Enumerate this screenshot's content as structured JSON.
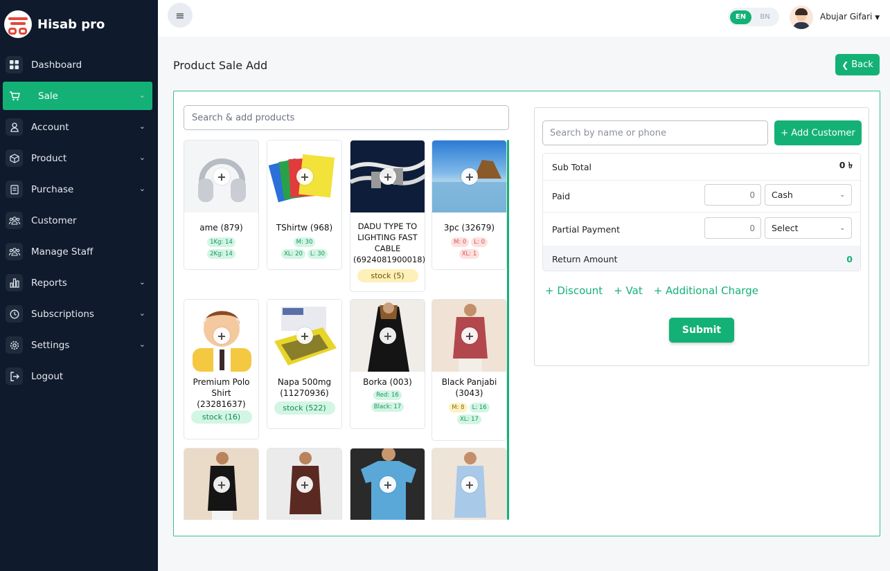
{
  "brand": {
    "name": "Hisab pro"
  },
  "sidebar": {
    "items": [
      {
        "label": "Dashboard",
        "icon": "grid-icon",
        "chevron": false
      },
      {
        "label": "Sale",
        "icon": "cart-icon",
        "chevron": true,
        "active": true
      },
      {
        "label": "Account",
        "icon": "user-icon",
        "chevron": true
      },
      {
        "label": "Product",
        "icon": "box-icon",
        "chevron": true
      },
      {
        "label": "Purchase",
        "icon": "receipt-icon",
        "chevron": true
      },
      {
        "label": "Customer",
        "icon": "users-icon",
        "chevron": false
      },
      {
        "label": "Manage Staff",
        "icon": "users-icon",
        "chevron": false
      },
      {
        "label": "Reports",
        "icon": "chart-icon",
        "chevron": true
      },
      {
        "label": "Subscriptions",
        "icon": "clock-icon",
        "chevron": true
      },
      {
        "label": "Settings",
        "icon": "gear-icon",
        "chevron": true
      },
      {
        "label": "Logout",
        "icon": "logout-icon",
        "chevron": false
      }
    ]
  },
  "topbar": {
    "lang_en": "EN",
    "lang_bn": "BN",
    "user_name": "Abujar Gifari"
  },
  "page": {
    "title": "Product Sale Add",
    "back_label": "Back"
  },
  "product_search": {
    "placeholder": "Search & add products"
  },
  "products": [
    {
      "name": "ame (879)",
      "tags": [
        {
          "t": "1Kg: 14",
          "c": "g"
        },
        {
          "t": "2Kg: 14",
          "c": "g"
        }
      ],
      "stock": ""
    },
    {
      "name": "TShirtw (968)",
      "tags": [
        {
          "t": "M: 30",
          "c": "g"
        },
        {
          "t": "XL: 20",
          "c": "g"
        },
        {
          "t": "L: 30",
          "c": "g"
        }
      ],
      "stock": ""
    },
    {
      "name": "DADU TYPE TO LIGHTING FAST CABLE (6924081900018)",
      "tags": [],
      "stock": "stock (5)"
    },
    {
      "name": "3pc (32679)",
      "tags": [
        {
          "t": "M: 0",
          "c": "r"
        },
        {
          "t": "L: 0",
          "c": "r"
        },
        {
          "t": "XL: 1",
          "c": "r"
        }
      ],
      "stock": ""
    },
    {
      "name": "Premium Polo Shirt (23281637)",
      "tags": [],
      "stock": "stock (16)"
    },
    {
      "name": "Napa 500mg (11270936)",
      "tags": [],
      "stock": "stock (522)"
    },
    {
      "name": "Borka (003)",
      "tags": [
        {
          "t": "Red: 16",
          "c": "g"
        },
        {
          "t": "Black: 17",
          "c": "g"
        }
      ],
      "stock": ""
    },
    {
      "name": "Black Panjabi (3043)",
      "tags": [
        {
          "t": "M: 8",
          "c": "y"
        },
        {
          "t": "L: 16",
          "c": "g"
        },
        {
          "t": "XL: 17",
          "c": "g"
        }
      ],
      "stock": ""
    },
    {
      "name": "",
      "tags": [],
      "stock": ""
    },
    {
      "name": "",
      "tags": [],
      "stock": ""
    },
    {
      "name": "",
      "tags": [],
      "stock": ""
    },
    {
      "name": "",
      "tags": [],
      "stock": ""
    }
  ],
  "customer": {
    "search_placeholder": "Search by name or phone",
    "add_label": "+ Add Customer"
  },
  "summary": {
    "subtotal_label": "Sub Total",
    "subtotal_value": "0 ৳",
    "paid_label": "Paid",
    "paid_value": "0",
    "paid_method": "Cash",
    "partial_label": "Partial Payment",
    "partial_value": "0",
    "partial_method": "Select",
    "return_label": "Return Amount",
    "return_value": "0"
  },
  "extras": {
    "discount": "+ Discount",
    "vat": "+ Vat",
    "charge": "+ Additional Charge"
  },
  "submit_label": "Submit",
  "colors": {
    "accent": "#14b176",
    "sidebar": "#0f1a2c"
  }
}
